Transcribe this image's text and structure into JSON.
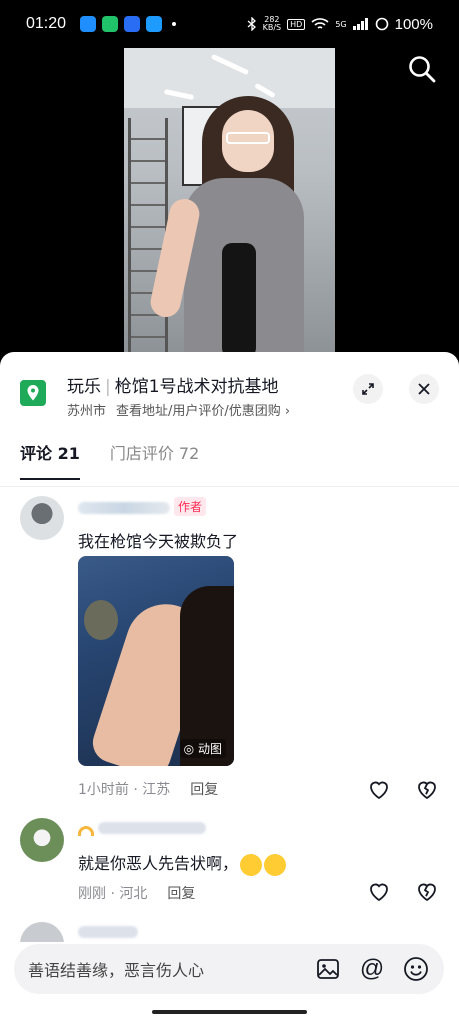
{
  "status_bar": {
    "time": "01:20",
    "net_speed_value": "282",
    "net_speed_unit": "KB/S",
    "hd_label": "HD",
    "signal_label": "5G",
    "battery": "100%",
    "app_colors": [
      "#1f8fff",
      "#20c36a",
      "#2a6df5",
      "#1e9bff"
    ]
  },
  "video": {
    "search_icon": "search-icon"
  },
  "poi": {
    "category": "玩乐",
    "name": "枪馆1号战术对抗基地",
    "city": "苏州市",
    "links": "查看地址/用户评价/优惠团购 ›",
    "icon_color": "#1faa59"
  },
  "tabs": [
    {
      "label": "评论 21",
      "active": true
    },
    {
      "label": "门店评价 72",
      "active": false
    }
  ],
  "comments": [
    {
      "author_badge": "作者",
      "text": "我在枪馆今天被欺负了",
      "image_tag": "动图",
      "time_location": "1小时前 · 江苏",
      "reply_label": "回复"
    },
    {
      "text": "就是你恶人先告状啊，",
      "time_location": "刚刚 · 河北",
      "reply_label": "回复"
    }
  ],
  "input": {
    "placeholder": "善语结善缘，恶言伤人心",
    "at_label": "@"
  },
  "colors": {
    "accent": "#fe2c55",
    "text": "#161823",
    "muted": "#8a8b91"
  }
}
